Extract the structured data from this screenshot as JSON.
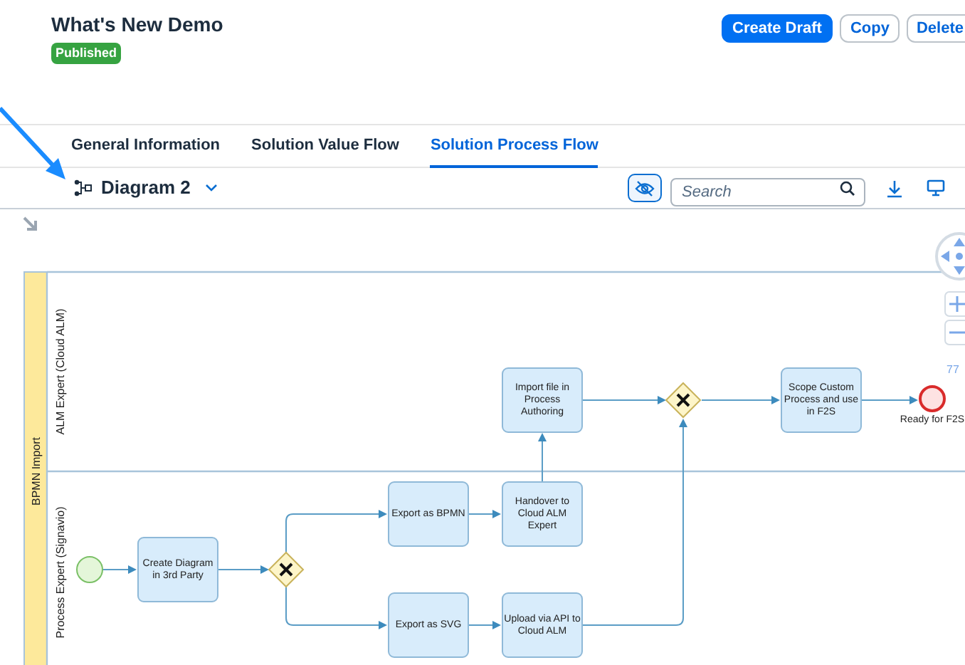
{
  "header": {
    "title": "What's New Demo",
    "status": "Published",
    "actions": [
      {
        "label": "Create Draft",
        "kind": "primary"
      },
      {
        "label": "Copy",
        "kind": "secondary"
      },
      {
        "label": "Delete",
        "kind": "secondary"
      }
    ]
  },
  "tabs": [
    {
      "label": "General Information",
      "selected": false
    },
    {
      "label": "Solution Value Flow",
      "selected": false
    },
    {
      "label": "Solution Process Flow",
      "selected": true
    }
  ],
  "toolbar": {
    "diagram": "Diagram 2",
    "search": {
      "placeholder": "Search"
    },
    "hide_toggle": {
      "on": true
    }
  },
  "diagram": {
    "pool": "BPMN Import",
    "lanes": [
      {
        "label": "ALM Expert (Cloud ALM)",
        "nodes": [
          {
            "kind": "task",
            "label": [
              "Import file in",
              "Process",
              "Authoring"
            ]
          },
          {
            "kind": "gateway"
          },
          {
            "kind": "task",
            "label": [
              "Scope Custom",
              "Process and use",
              "in F2S"
            ]
          },
          {
            "kind": "end",
            "label": [
              "Ready for F2S"
            ]
          }
        ]
      },
      {
        "label": "Process Expert (Signavio)",
        "nodes": [
          {
            "kind": "task",
            "label": [
              "Export as BPMN"
            ]
          },
          {
            "kind": "task",
            "label": [
              "Handover to",
              "Cloud ALM",
              "Expert"
            ]
          },
          {
            "kind": "start"
          },
          {
            "kind": "task",
            "label": [
              "Create Diagram",
              "in 3rd Party"
            ]
          },
          {
            "kind": "gateway"
          },
          {
            "kind": "task",
            "label": [
              "Export as SVG"
            ]
          },
          {
            "kind": "task",
            "label": [
              "Upload via API to",
              "Cloud ALM"
            ]
          }
        ]
      }
    ],
    "zoom": "77"
  }
}
